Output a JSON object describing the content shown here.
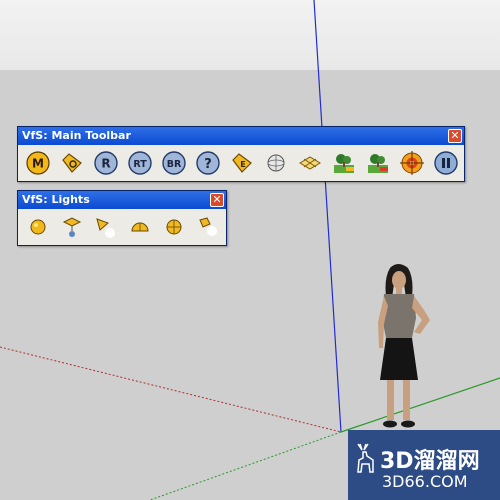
{
  "viewport": {
    "sky_color": "#eeeeee",
    "ground_color": "#cfcfcf",
    "axis_colors": {
      "blue_axis": "#1f2ccf",
      "red_axis": "#b03030",
      "green_axis": "#2a9a2a"
    }
  },
  "main_toolbar": {
    "title": "VfS: Main Toolbar",
    "close_symbol": "✕",
    "buttons": [
      {
        "name": "m-button",
        "label": "M",
        "icon": "m-icon"
      },
      {
        "name": "tag-button",
        "label": "",
        "icon": "tag-icon"
      },
      {
        "name": "r-button",
        "label": "R",
        "icon": "r-icon"
      },
      {
        "name": "rt-button",
        "label": "RT",
        "icon": "rt-icon"
      },
      {
        "name": "br-button",
        "label": "BR",
        "icon": "br-icon"
      },
      {
        "name": "help-button",
        "label": "?",
        "icon": "help-icon"
      },
      {
        "name": "e-tag-button",
        "label": "E",
        "icon": "e-tag-icon"
      },
      {
        "name": "sphere-button",
        "label": "",
        "icon": "sphere-icon"
      },
      {
        "name": "gem-button",
        "label": "",
        "icon": "gem-icon"
      },
      {
        "name": "landscape-button",
        "label": "",
        "icon": "landscape-icon"
      },
      {
        "name": "landscape-red-button",
        "label": "",
        "icon": "landscape-red-icon"
      },
      {
        "name": "target-button",
        "label": "",
        "icon": "target-icon"
      },
      {
        "name": "pause-button",
        "label": "",
        "icon": "pause-icon"
      }
    ]
  },
  "lights_toolbar": {
    "title": "VfS: Lights",
    "close_symbol": "✕",
    "buttons": [
      {
        "name": "omni-light-button",
        "icon": "omni-light-icon"
      },
      {
        "name": "spot-light-button",
        "icon": "spot-light-icon"
      },
      {
        "name": "cone-light-button",
        "icon": "cone-light-icon"
      },
      {
        "name": "dome-light-button",
        "icon": "dome-light-icon"
      },
      {
        "name": "sphere-light-button",
        "icon": "sphere-light-icon"
      },
      {
        "name": "lamp-light-button",
        "icon": "lamp-light-icon"
      }
    ]
  },
  "watermark": {
    "text": "3D溜溜网",
    "sub": "3D66.COM"
  }
}
